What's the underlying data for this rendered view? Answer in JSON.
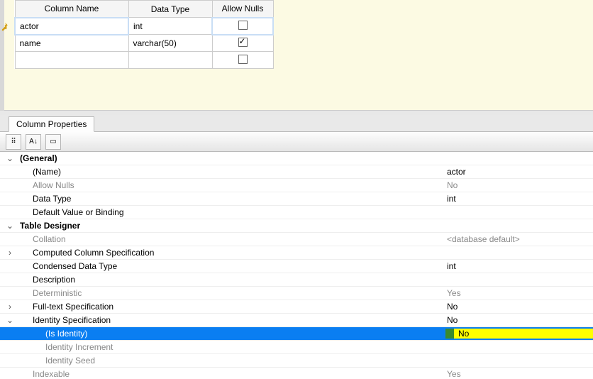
{
  "grid": {
    "headers": {
      "col_name": "Column Name",
      "data_type": "Data Type",
      "allow_nulls": "Allow Nulls"
    },
    "rows": [
      {
        "name": "actor",
        "type": "int",
        "allow_nulls": false,
        "pk": true,
        "selected": true
      },
      {
        "name": "name",
        "type": "varchar(50)",
        "allow_nulls": true,
        "pk": false,
        "selected": false
      },
      {
        "name": "",
        "type": "",
        "allow_nulls": false,
        "pk": false,
        "selected": false
      }
    ]
  },
  "panel": {
    "tab_title": "Column Properties",
    "rows": [
      {
        "kind": "group",
        "exp": "v",
        "label": "(General)",
        "value": ""
      },
      {
        "kind": "prop",
        "exp": "",
        "label": "(Name)",
        "value": "actor",
        "indent": 1
      },
      {
        "kind": "dim",
        "exp": "",
        "label": "Allow Nulls",
        "value": "No",
        "indent": 1
      },
      {
        "kind": "prop",
        "exp": "",
        "label": "Data Type",
        "value": "int",
        "indent": 1
      },
      {
        "kind": "prop",
        "exp": "",
        "label": "Default Value or Binding",
        "value": "",
        "indent": 1
      },
      {
        "kind": "group",
        "exp": "v",
        "label": "Table Designer",
        "value": ""
      },
      {
        "kind": "dim",
        "exp": "",
        "label": "Collation",
        "value": "<database default>",
        "indent": 1
      },
      {
        "kind": "prop",
        "exp": ">",
        "label": "Computed Column Specification",
        "value": "",
        "indent": 1
      },
      {
        "kind": "prop",
        "exp": "",
        "label": "Condensed Data Type",
        "value": "int",
        "indent": 1
      },
      {
        "kind": "prop",
        "exp": "",
        "label": "Description",
        "value": "",
        "indent": 1
      },
      {
        "kind": "dim",
        "exp": "",
        "label": "Deterministic",
        "value": "Yes",
        "indent": 1
      },
      {
        "kind": "prop",
        "exp": ">",
        "label": "Full-text Specification",
        "value": "No",
        "indent": 1
      },
      {
        "kind": "prop",
        "exp": "v",
        "label": "Identity Specification",
        "value": "No",
        "indent": 1
      },
      {
        "kind": "highlight",
        "exp": "",
        "label": "(Is Identity)",
        "value": "No",
        "indent": 2
      },
      {
        "kind": "dim",
        "exp": "",
        "label": "Identity Increment",
        "value": "",
        "indent": 2
      },
      {
        "kind": "dim",
        "exp": "",
        "label": "Identity Seed",
        "value": "",
        "indent": 2
      },
      {
        "kind": "dim",
        "exp": "",
        "label": "Indexable",
        "value": "Yes",
        "indent": 1
      }
    ]
  },
  "toolbar": {
    "btn_categorized": "⠿",
    "btn_sort": "A↓",
    "btn_pages": "▭"
  }
}
